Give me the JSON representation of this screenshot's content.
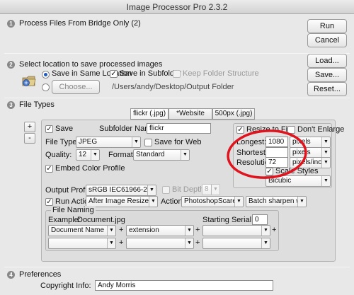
{
  "window": {
    "title": "Image Processor Pro 2.3.2"
  },
  "section1": {
    "num": "1",
    "label": "Process Files From Bridge Only (2)"
  },
  "right_buttons": {
    "run": "Run",
    "cancel": "Cancel",
    "load": "Load...",
    "save": "Save...",
    "reset": "Reset..."
  },
  "section2": {
    "num": "2",
    "label": "Select location to save processed images",
    "save_same_location": "Save in Same Location",
    "save_in_subfolder": "Save in Subfolder",
    "keep_folder_structure": "Keep Folder Structure",
    "choose_label": "Choose...",
    "path": "/Users/andy/Desktop/Output Folder"
  },
  "section3": {
    "num": "3",
    "label": "File Types",
    "add_label": "+",
    "remove_label": "-",
    "tabs": [
      "flickr (.jpg)",
      "*Website (.jpg)",
      "500px (.jpg)"
    ],
    "save_label": "Save",
    "subfolder_name_label": "Subfolder Name:",
    "subfolder_name_value": "flickr",
    "file_type_label": "File Type:",
    "file_type_value": "JPEG",
    "save_for_web_label": "Save for Web",
    "quality_label": "Quality:",
    "quality_value": "12",
    "format_label": "Format:",
    "format_value": "Standard",
    "embed_profile_label": "Embed Color Profile",
    "resize_to_fit_label": "Resize to Fit",
    "dont_enlarge_label": "Don't Enlarge",
    "longest_label": "Longest:",
    "longest_value": "1080",
    "longest_unit": "pixels",
    "shortest_label": "Shortest:",
    "shortest_value": "",
    "shortest_unit": "pixels",
    "resolution_label": "Resolution:",
    "resolution_value": "72",
    "resolution_unit": "pixels/inch",
    "scale_styles_label": "Scale Styles",
    "interpolation_value": "Bicubic",
    "output_profile_label": "Output Profile:",
    "output_profile_value": "sRGB IEC61966-2.1",
    "bit_depth_label": "Bit Depth:",
    "bit_depth_value": "8",
    "run_action_label": "Run Action:",
    "run_action_value": "After Image Resize",
    "action_label": "Action:",
    "action_set_value": "PhotoshopScaresMe",
    "action_value": "Batch sharpen wit...",
    "file_naming_label": "File Naming",
    "example_label": "Example:",
    "example_value": "Document.jpg",
    "starting_serial_label": "Starting Serial #:",
    "starting_serial_value": "0",
    "naming_row1": [
      "Document Name",
      "extension",
      ""
    ],
    "naming_row2": [
      "",
      "",
      ""
    ],
    "plus": "+"
  },
  "section4": {
    "num": "4",
    "label": "Preferences",
    "copyright_label": "Copyright Info:",
    "copyright_value": "Andy Morris"
  },
  "annotation": {
    "color": "#e0141e"
  }
}
